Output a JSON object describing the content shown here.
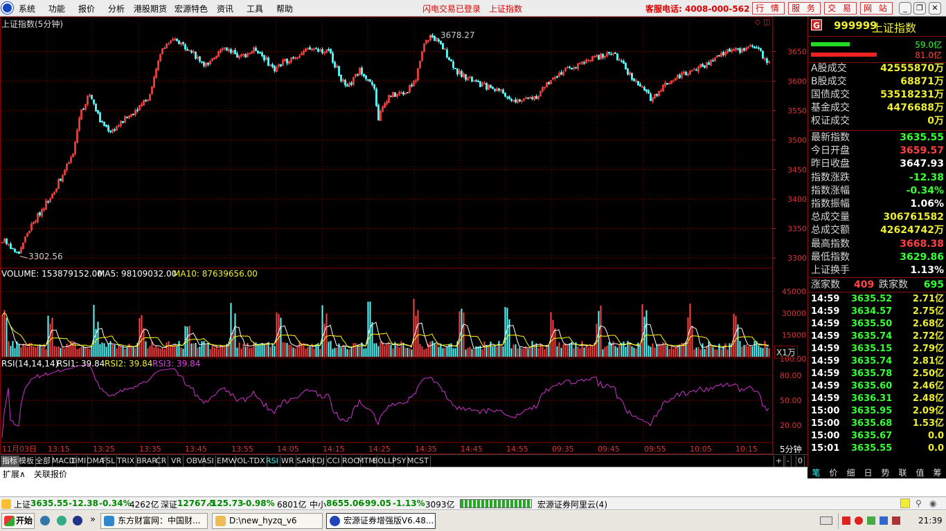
{
  "menu": {
    "items": [
      "系统",
      "功能",
      "报价",
      "分析",
      "港股期货",
      "宏源特色",
      "资讯",
      "工具",
      "帮助"
    ],
    "login_status": "闪电交易已登录",
    "current_index": "上证指数",
    "service_phone": "客服电话: 4008-000-562",
    "buttons": [
      "行 情",
      "服 务",
      "交 易",
      "网 站"
    ]
  },
  "chart": {
    "title": "上证指数(5分钟)",
    "high_label": "3678.27",
    "low_label": "3302.56",
    "volume_legend": {
      "vol": "VOLUME: 153879152.00",
      "ma5": "MA5: 98109032.00",
      "ma10": "MA10: 87639656.00"
    },
    "volume_unit": "X1万",
    "rsi_legend": {
      "name": "RSI(14,14,14)",
      "rsi1": "RSI1: 39.84",
      "rsi2": "RSI2: 39.84",
      "rsi3": "RSI3: 39.84"
    },
    "period_label": "5分钟",
    "colors": {
      "up": "#ff4040",
      "down": "#54ffff",
      "grid": "#8b0000",
      "ma5": "#ffffff",
      "ma10": "#ffff00",
      "rsi": "#cc33cc"
    }
  },
  "chart_data": {
    "type": "line",
    "price_axis": {
      "ticks": [
        3300,
        3350,
        3400,
        3450,
        3500,
        3550,
        3600,
        3650
      ],
      "ylim": [
        3285,
        3700
      ]
    },
    "volume_axis": {
      "ticks": [
        15000,
        30000,
        45000
      ],
      "ylim": [
        0,
        52000
      ]
    },
    "rsi_axis": {
      "ticks": [
        "20.00",
        "50.00",
        "80.00",
        "100.00"
      ],
      "ylim": [
        0,
        100
      ]
    },
    "x_ticks": [
      "11月03日",
      "13:15",
      "13:25",
      "13:35",
      "13:45",
      "13:55",
      "14:05",
      "14:15",
      "14:25",
      "14:35",
      "14:45",
      "14:55",
      "09:35",
      "09:45",
      "09:55",
      "10:05",
      "10:15"
    ],
    "price_keypoints": [
      [
        0,
        3325
      ],
      [
        8,
        3330
      ],
      [
        25,
        3305
      ],
      [
        40,
        3345
      ],
      [
        80,
        3420
      ],
      [
        105,
        3475
      ],
      [
        115,
        3545
      ],
      [
        130,
        3580
      ],
      [
        145,
        3530
      ],
      [
        160,
        3515
      ],
      [
        190,
        3545
      ],
      [
        215,
        3575
      ],
      [
        235,
        3660
      ],
      [
        255,
        3670
      ],
      [
        285,
        3640
      ],
      [
        300,
        3625
      ],
      [
        320,
        3660
      ],
      [
        345,
        3640
      ],
      [
        370,
        3655
      ],
      [
        395,
        3620
      ],
      [
        420,
        3640
      ],
      [
        450,
        3655
      ],
      [
        475,
        3650
      ],
      [
        490,
        3610
      ],
      [
        500,
        3585
      ],
      [
        520,
        3620
      ],
      [
        540,
        3590
      ],
      [
        545,
        3535
      ],
      [
        560,
        3575
      ],
      [
        585,
        3580
      ],
      [
        600,
        3605
      ],
      [
        612,
        3662
      ],
      [
        622,
        3678
      ],
      [
        640,
        3655
      ],
      [
        660,
        3615
      ],
      [
        690,
        3595
      ],
      [
        720,
        3585
      ],
      [
        745,
        3565
      ],
      [
        775,
        3575
      ],
      [
        800,
        3610
      ],
      [
        830,
        3625
      ],
      [
        860,
        3640
      ],
      [
        885,
        3648
      ],
      [
        900,
        3625
      ],
      [
        920,
        3595
      ],
      [
        940,
        3570
      ],
      [
        960,
        3595
      ],
      [
        990,
        3615
      ],
      [
        1020,
        3628
      ],
      [
        1055,
        3655
      ],
      [
        1070,
        3650
      ],
      [
        1090,
        3660
      ],
      [
        1110,
        3630
      ]
    ]
  },
  "quote": {
    "code": "999999",
    "name": "上证指数",
    "flow_up": "59.0亿",
    "flow_down": "81.0亿",
    "flow_up_ratio": 0.42,
    "flow_down_ratio": 0.58,
    "turnover": [
      {
        "k": "A股成交",
        "v": "42555870万"
      },
      {
        "k": "B股成交",
        "v": "68871万"
      },
      {
        "k": "国债成交",
        "v": "53518231万"
      },
      {
        "k": "基金成交",
        "v": "4476688万"
      },
      {
        "k": "权证成交",
        "v": "0万"
      }
    ],
    "stats": [
      {
        "k": "最新指数",
        "v": "3635.55",
        "c": "#3f3"
      },
      {
        "k": "今日开盘",
        "v": "3659.57",
        "c": "#ff4040"
      },
      {
        "k": "昨日收盘",
        "v": "3647.93",
        "c": "#fff"
      },
      {
        "k": "指数涨跌",
        "v": "-12.38",
        "c": "#3f3"
      },
      {
        "k": "指数涨幅",
        "v": "-0.34%",
        "c": "#3f3"
      },
      {
        "k": "指数振幅",
        "v": "1.06%",
        "c": "#fff"
      },
      {
        "k": "总成交量",
        "v": "306761582",
        "c": "#ee3"
      },
      {
        "k": "总成交额",
        "v": "42624742万",
        "c": "#ee3"
      },
      {
        "k": "最高指数",
        "v": "3668.38",
        "c": "#ff4040"
      },
      {
        "k": "最低指数",
        "v": "3629.86",
        "c": "#3f3"
      },
      {
        "k": "上证换手",
        "v": "1.13%",
        "c": "#fff"
      }
    ],
    "rise_label": "涨家数",
    "rise_count": "409",
    "fall_label": "跌家数",
    "fall_count": "695",
    "ticks": [
      {
        "t": "14:59",
        "p": "3635.52",
        "q": "2.71亿"
      },
      {
        "t": "14:59",
        "p": "3634.57",
        "q": "2.75亿"
      },
      {
        "t": "14:59",
        "p": "3635.50",
        "q": "2.68亿"
      },
      {
        "t": "14:59",
        "p": "3635.74",
        "q": "2.72亿"
      },
      {
        "t": "14:59",
        "p": "3635.15",
        "q": "2.79亿"
      },
      {
        "t": "14:59",
        "p": "3635.74",
        "q": "2.81亿"
      },
      {
        "t": "14:59",
        "p": "3635.78",
        "q": "2.50亿"
      },
      {
        "t": "14:59",
        "p": "3635.60",
        "q": "2.46亿"
      },
      {
        "t": "14:59",
        "p": "3636.31",
        "q": "2.48亿"
      },
      {
        "t": "15:00",
        "p": "3635.95",
        "q": "2.09亿"
      },
      {
        "t": "15:00",
        "p": "3635.68",
        "q": "1.53亿"
      },
      {
        "t": "15:00",
        "p": "3635.67",
        "q": "0.0"
      },
      {
        "t": "15:01",
        "p": "3635.55",
        "q": "0.0"
      }
    ],
    "bottom_tabs": [
      "笔",
      "价",
      "细",
      "日",
      "势",
      "联",
      "值",
      "筹"
    ]
  },
  "indicator_tabs": [
    "指标",
    "模板",
    "全部",
    "MACD",
    "DMI",
    "DMA",
    "FSL",
    "TRIX",
    "BRAR",
    "CR",
    "VR",
    "OBV",
    "ASI",
    "EMV",
    "VOL-TDX",
    "RSI",
    "WR",
    "SAR",
    "KDJ",
    "CCI",
    "ROC",
    "MTM",
    "BOLL",
    "PSY",
    "MCST"
  ],
  "indicator_active": "RSI",
  "indicator_right": [
    "+",
    "-",
    "0"
  ],
  "expand_bar": [
    "扩展∧",
    "关联报价"
  ],
  "status": {
    "sh_name": "上证",
    "sh_price": "3635.55",
    "sh_chg": "-12.38",
    "sh_pct": "-0.34%",
    "sh_amt": "4262亿",
    "sz_name": "深证",
    "sz_price": "12767.5",
    "sz_chg": "-125.73",
    "sz_pct": "-0.98%",
    "sz_amt": "6801亿",
    "zx_name": "中小",
    "zx_price": "8655.06",
    "zx_chg": "-99.05",
    "zx_pct": "-1.13%",
    "zx_amt": "3093亿",
    "server": "宏源证券阿里云(4)"
  },
  "taskbar": {
    "start": "开始",
    "tasks": [
      "东方财富网：中国财...",
      "D:\\new_hyzq_v6",
      "宏源证券增强版V6.48..."
    ],
    "clock": "21:39"
  }
}
